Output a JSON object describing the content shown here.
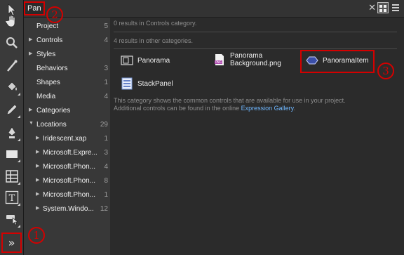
{
  "search": {
    "value": "Pan"
  },
  "toolbar": {
    "tools": [
      {
        "icon": "pointer-icon",
        "top": 0
      },
      {
        "icon": "hand-icon"
      },
      {
        "icon": "zoom-icon"
      },
      {
        "icon": "eyedropper-icon"
      },
      {
        "icon": "paint-bucket-icon"
      },
      {
        "icon": "pencil-icon"
      },
      {
        "icon": "pen-icon"
      },
      {
        "icon": "rectangle-icon"
      },
      {
        "icon": "grid-icon"
      },
      {
        "icon": "text-icon"
      },
      {
        "icon": "hand-select-icon"
      }
    ],
    "more_label": "»"
  },
  "categories": [
    {
      "label": "Project",
      "count": "5",
      "arrow": ""
    },
    {
      "label": "Controls",
      "count": "4",
      "arrow": "▶"
    },
    {
      "label": "Styles",
      "count": "",
      "arrow": "▶"
    },
    {
      "label": "Behaviors",
      "count": "3",
      "arrow": ""
    },
    {
      "label": "Shapes",
      "count": "1",
      "arrow": ""
    },
    {
      "label": "Media",
      "count": "4",
      "arrow": ""
    },
    {
      "label": "Categories",
      "count": "",
      "arrow": "▶"
    },
    {
      "label": "Locations",
      "count": "29",
      "arrow": "▼"
    },
    {
      "label": "Iridescent.xap",
      "count": "1",
      "arrow": "▶"
    },
    {
      "label": "Microsoft.Expre...",
      "count": "3",
      "arrow": "▶"
    },
    {
      "label": "Microsoft.Phon...",
      "count": "4",
      "arrow": "▶"
    },
    {
      "label": "Microsoft.Phon...",
      "count": "8",
      "arrow": "▶"
    },
    {
      "label": "Microsoft.Phon...",
      "count": "1",
      "arrow": "▶"
    },
    {
      "label": "System.Windo...",
      "count": "12",
      "arrow": "▶"
    }
  ],
  "results": {
    "in_category": "0 results in Controls category.",
    "other_categories": "4 results in other categories.",
    "items": [
      {
        "label": "Panorama",
        "icon": "panorama-icon"
      },
      {
        "label_line1": "Panorama",
        "label_line2": "Background.png",
        "icon": "png-file-icon"
      },
      {
        "label": "PanoramaItem",
        "icon": "panorama-item-icon"
      },
      {
        "label": "StackPanel",
        "icon": "stackpanel-icon"
      }
    ],
    "description_line1": "This category shows the common controls that are available for use in your project.",
    "description_line2": "Additional controls can be found in the online ",
    "gallery_link": "Expression Gallery",
    "description_end": "."
  },
  "annotations": {
    "one": "1",
    "two": "2",
    "three": "3"
  },
  "colors": {
    "annotation": "#d40000",
    "link": "#6fb7ff",
    "background": "#2b2b2b"
  }
}
